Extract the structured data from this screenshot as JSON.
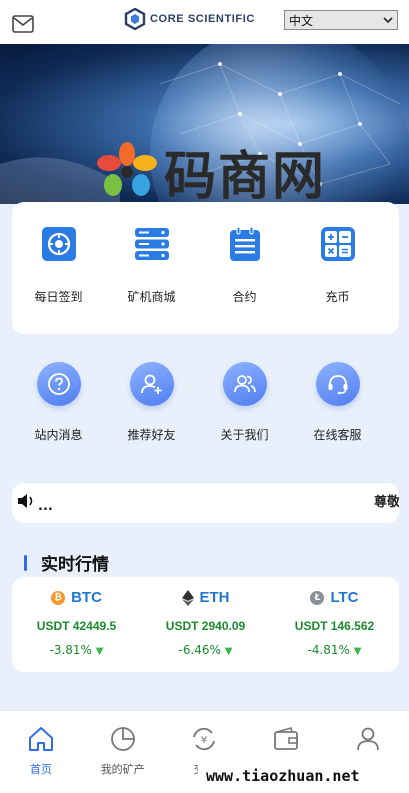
{
  "header": {
    "logo_text": "CORE SCIENTIFIC",
    "language": "中文"
  },
  "banner": {
    "watermark_text": "码商网"
  },
  "quick_menu": [
    {
      "label": "每日签到",
      "icon": "checkin-icon"
    },
    {
      "label": "矿机商城",
      "icon": "miner-shop-icon"
    },
    {
      "label": "合约",
      "icon": "contract-icon"
    },
    {
      "label": "充币",
      "icon": "calculator-icon"
    }
  ],
  "circle_menu": [
    {
      "label": "站内消息",
      "icon": "question-icon"
    },
    {
      "label": "推荐好友",
      "icon": "add-user-icon"
    },
    {
      "label": "关于我们",
      "icon": "users-icon"
    },
    {
      "label": "在线客服",
      "icon": "headset-icon"
    }
  ],
  "notice": {
    "dots": "...",
    "marquee": "尊敬"
  },
  "market": {
    "title": "实时行情",
    "coins": [
      {
        "symbol": "BTC",
        "price": "USDT 42449.5",
        "change": "-3.81%",
        "icon_color": "#f29a2e",
        "icon": "bitcoin-icon"
      },
      {
        "symbol": "ETH",
        "price": "USDT 2940.09",
        "change": "-6.46%",
        "icon_color": "#333333",
        "icon": "ethereum-icon"
      },
      {
        "symbol": "LTC",
        "price": "USDT 146.562",
        "change": "-4.81%",
        "icon_color": "#8a8f99",
        "icon": "litecoin-icon"
      }
    ]
  },
  "bottom_nav": [
    {
      "label": "首页",
      "icon": "home-icon",
      "active": true
    },
    {
      "label": "我的矿产",
      "icon": "pie-chart-icon",
      "active": false
    },
    {
      "label": "交易",
      "icon": "exchange-icon",
      "active": false
    },
    {
      "label": "",
      "icon": "wallet-icon",
      "active": false
    },
    {
      "label": "",
      "icon": "user-icon",
      "active": false
    }
  ],
  "site_watermark": "www.tiaozhuan.net",
  "colors": {
    "accent": "#2f6ee8",
    "up_green": "#1b8a2e",
    "coin_name": "#1f78d1"
  }
}
